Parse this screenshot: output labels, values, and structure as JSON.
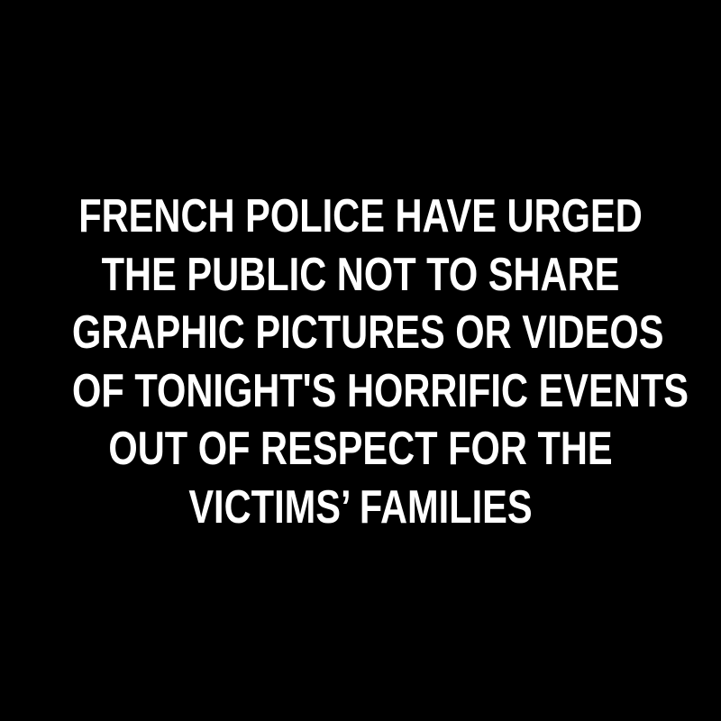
{
  "message": {
    "lines": [
      "FRENCH POLICE HAVE URGED",
      "THE PUBLIC NOT TO SHARE",
      "GRAPHIC PICTURES OR VIDEOS",
      "OF TONIGHT'S HORRIFIC EVENTS",
      "OUT OF RESPECT FOR THE",
      "VICTIMS’ FAMILIES"
    ]
  },
  "colors": {
    "background": "#000000",
    "text": "#ffffff"
  }
}
